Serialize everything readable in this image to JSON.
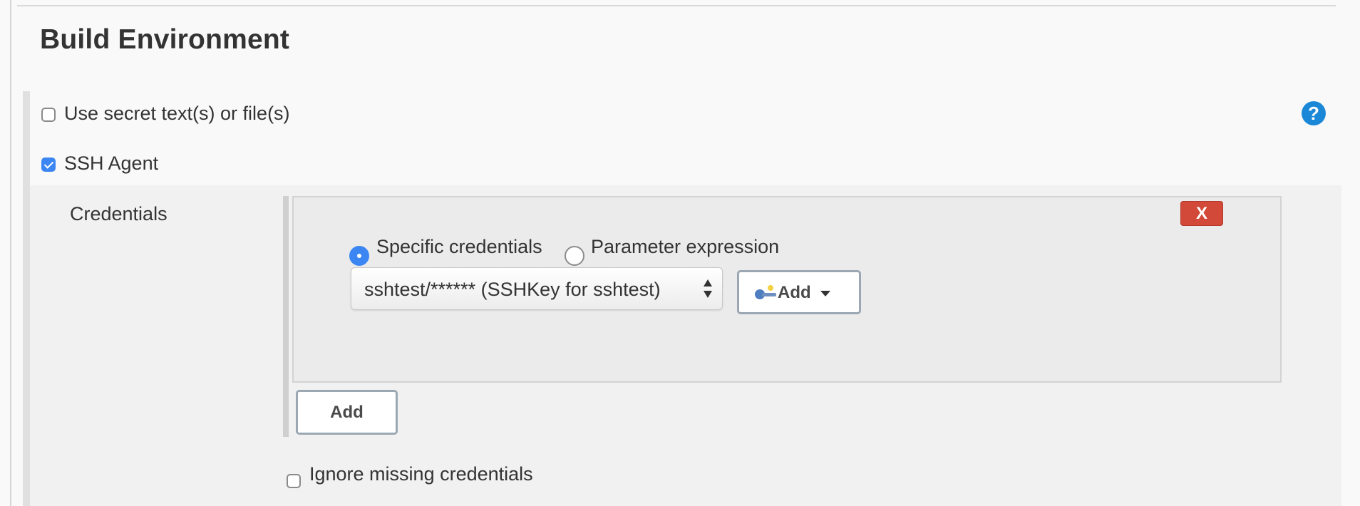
{
  "section": {
    "title": "Build Environment"
  },
  "options": [
    {
      "label": "Use secret text(s) or file(s)",
      "checked": false
    },
    {
      "label": "SSH Agent",
      "checked": true
    }
  ],
  "help": {
    "glyph": "?",
    "icon": "help-icon"
  },
  "ssh_agent": {
    "credentials_label": "Credentials",
    "delete_label": "X",
    "radio_specific": "Specific credentials",
    "radio_parameter": "Parameter expression",
    "selected_radio": "Specific credentials",
    "selected_credential": "sshtest/****** (SSHKey for sshtest)",
    "add_credential_label": "Add",
    "add_label": "Add",
    "ignore_missing_label": "Ignore missing credentials",
    "ignore_missing_checked": false
  },
  "colors": {
    "accent": "#3b86f2",
    "danger": "#d24939",
    "help": "#1b87d7",
    "panel": "#f1f1f1",
    "box": "#ebebeb"
  }
}
